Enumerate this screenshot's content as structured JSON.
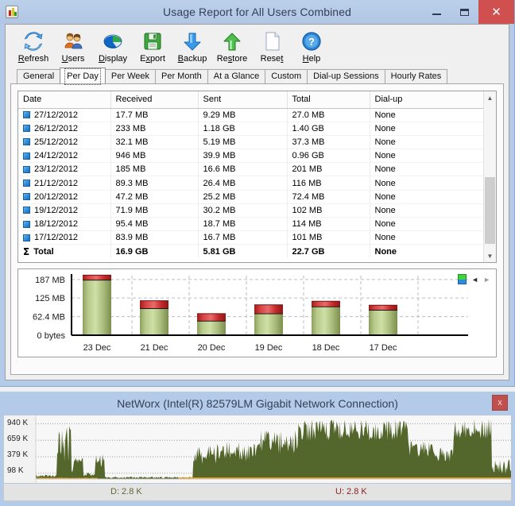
{
  "window": {
    "title": "Usage Report for All Users Combined",
    "icon": "chart-bars-icon",
    "minimize_label": "–",
    "maximize_label": "❐",
    "close_label": "✕"
  },
  "toolbar": {
    "items": [
      {
        "label": "Refresh",
        "accel": "R",
        "icon": "refresh-icon"
      },
      {
        "label": "Users",
        "accel": "U",
        "icon": "users-icon"
      },
      {
        "label": "Display",
        "accel": "D",
        "icon": "display-pie-icon"
      },
      {
        "label": "Export",
        "accel": "x",
        "icon": "export-floppy-icon"
      },
      {
        "label": "Backup",
        "accel": "B",
        "icon": "backup-down-arrow-icon"
      },
      {
        "label": "Restore",
        "accel": "s",
        "icon": "restore-up-arrow-icon"
      },
      {
        "label": "Reset",
        "accel": "t",
        "icon": "reset-page-icon"
      },
      {
        "label": "Help",
        "accel": "H",
        "icon": "help-question-icon"
      }
    ]
  },
  "tabs": {
    "items": [
      "General",
      "Per Day",
      "Per Week",
      "Per Month",
      "At a Glance",
      "Custom",
      "Dial-up Sessions",
      "Hourly Rates"
    ],
    "active": "Per Day"
  },
  "table": {
    "columns": [
      "Date",
      "Received",
      "Sent",
      "Total",
      "Dial-up"
    ],
    "rows": [
      {
        "date": "27/12/2012",
        "received": "17.7 MB",
        "sent": "9.29 MB",
        "total": "27.0 MB",
        "dialup": "None"
      },
      {
        "date": "26/12/2012",
        "received": "233 MB",
        "sent": "1.18 GB",
        "total": "1.40 GB",
        "dialup": "None"
      },
      {
        "date": "25/12/2012",
        "received": "32.1 MB",
        "sent": "5.19 MB",
        "total": "37.3 MB",
        "dialup": "None"
      },
      {
        "date": "24/12/2012",
        "received": "946 MB",
        "sent": "39.9 MB",
        "total": "0.96 GB",
        "dialup": "None"
      },
      {
        "date": "23/12/2012",
        "received": "185 MB",
        "sent": "16.6 MB",
        "total": "201 MB",
        "dialup": "None"
      },
      {
        "date": "21/12/2012",
        "received": "89.3 MB",
        "sent": "26.4 MB",
        "total": "116 MB",
        "dialup": "None"
      },
      {
        "date": "20/12/2012",
        "received": "47.2 MB",
        "sent": "25.2 MB",
        "total": "72.4 MB",
        "dialup": "None"
      },
      {
        "date": "19/12/2012",
        "received": "71.9 MB",
        "sent": "30.2 MB",
        "total": "102 MB",
        "dialup": "None"
      },
      {
        "date": "18/12/2012",
        "received": "95.4 MB",
        "sent": "18.7 MB",
        "total": "114 MB",
        "dialup": "None"
      },
      {
        "date": "17/12/2012",
        "received": "83.9 MB",
        "sent": "16.7 MB",
        "total": "101 MB",
        "dialup": "None"
      }
    ],
    "total_row": {
      "date": "Total",
      "received": "16.9 GB",
      "sent": "5.81 GB",
      "total": "22.7 GB",
      "dialup": "None"
    },
    "sigma": "Σ"
  },
  "chart_data": {
    "type": "bar",
    "stacked": true,
    "title": "",
    "xlabel": "",
    "ylabel": "",
    "categories": [
      "23 Dec",
      "21 Dec",
      "20 Dec",
      "19 Dec",
      "18 Dec",
      "17 Dec"
    ],
    "ytick_labels": [
      "187 MB",
      "125 MB",
      "62.4 MB",
      "0 bytes"
    ],
    "ytick_values": [
      187,
      125,
      62.4,
      0
    ],
    "ylim": [
      0,
      200
    ],
    "grid": true,
    "legend_position": "top-right",
    "series": [
      {
        "name": "Received",
        "color": "#9ab866",
        "values": [
          185,
          89.3,
          47.2,
          71.9,
          95.4,
          83.9
        ]
      },
      {
        "name": "Sent",
        "color": "#cc2b2b",
        "values": [
          16.6,
          26.4,
          25.2,
          30.2,
          18.7,
          16.7
        ]
      }
    ],
    "nav": {
      "prev": "◄",
      "next": "►"
    }
  },
  "networx": {
    "title": "NetWorx (Intel(R) 82579LM Gigabit Network Connection)",
    "close_label": "x",
    "graph": {
      "ytick_labels": [
        "940 K",
        "659 K",
        "379 K",
        "98 K"
      ],
      "ytick_values": [
        940,
        659,
        379,
        98
      ],
      "download_color": "#53662b",
      "upload_color": "#f0a020"
    },
    "status": {
      "download": "D: 2.8 K",
      "upload": "U: 2.8 K"
    }
  }
}
